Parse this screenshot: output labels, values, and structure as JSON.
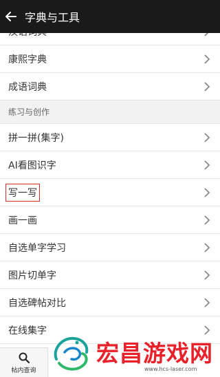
{
  "header": {
    "title": "字典与工具"
  },
  "items_top": [
    {
      "label": "汉语词典"
    },
    {
      "label": "康熙字典"
    },
    {
      "label": "成语词典"
    }
  ],
  "section": {
    "label": "练习与创作"
  },
  "items": [
    {
      "label": "拼一拼(集字)"
    },
    {
      "label": "AI看图识字"
    },
    {
      "label": "写一写"
    },
    {
      "label": "画一画"
    },
    {
      "label": "自选单字学习"
    },
    {
      "label": "图片切单字"
    },
    {
      "label": "自选碑帖对比"
    },
    {
      "label": "在线集字"
    }
  ],
  "bottom": {
    "search_label": "帖内查询"
  },
  "watermark": {
    "brand": "宏昌游戏网",
    "url": "www.hcs-laser.com"
  },
  "colors": {
    "header_bg": "#1a1a1a",
    "highlight_border": "#d42a2a",
    "watermark_red": "#e8212b"
  }
}
